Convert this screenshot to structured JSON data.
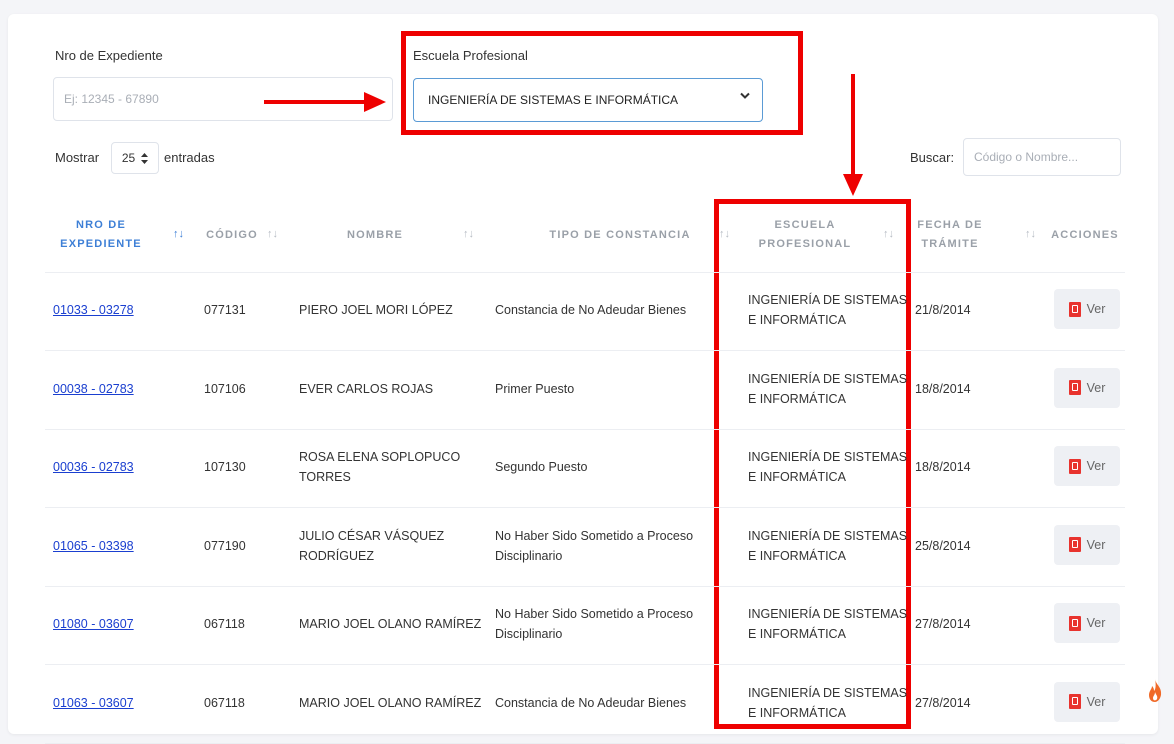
{
  "filters": {
    "expediente_label": "Nro de Expediente",
    "expediente_placeholder": "Ej: 12345 - 67890",
    "escuela_label": "Escuela Profesional",
    "escuela_selected": "INGENIERÍA DE SISTEMAS E INFORMÁTICA"
  },
  "length": {
    "mostrar": "Mostrar",
    "value": "25",
    "entradas": "entradas"
  },
  "search": {
    "label": "Buscar:",
    "placeholder": "Código o Nombre..."
  },
  "columns": {
    "expediente_1": "NRO DE",
    "expediente_2": "EXPEDIENTE",
    "codigo": "CÓDIGO",
    "nombre": "NOMBRE",
    "tipo": "TIPO DE CONSTANCIA",
    "escuela_1": "ESCUELA",
    "escuela_2": "PROFESIONAL",
    "fecha_1": "FECHA DE",
    "fecha_2": "TRÁMITE",
    "acciones": "ACCIONES"
  },
  "rows": [
    {
      "exp": "01033 - 03278",
      "cod": "077131",
      "nom1": "PIERO JOEL MORI LÓPEZ",
      "nom2": "",
      "tipo1": "Constancia de No Adeudar Bienes",
      "tipo2": "",
      "esc1": "INGENIERÍA DE SISTEMAS",
      "esc2": "E INFORMÁTICA",
      "fecha": "21/8/2014",
      "btn": "Ver"
    },
    {
      "exp": "00038 - 02783",
      "cod": "107106",
      "nom1": "EVER CARLOS ROJAS",
      "nom2": "",
      "tipo1": "Primer Puesto",
      "tipo2": "",
      "esc1": "INGENIERÍA DE SISTEMAS",
      "esc2": "E INFORMÁTICA",
      "fecha": "18/8/2014",
      "btn": "Ver"
    },
    {
      "exp": "00036 - 02783",
      "cod": "107130",
      "nom1": "ROSA ELENA SOPLOPUCO",
      "nom2": "TORRES",
      "tipo1": "Segundo Puesto",
      "tipo2": "",
      "esc1": "INGENIERÍA DE SISTEMAS",
      "esc2": "E INFORMÁTICA",
      "fecha": "18/8/2014",
      "btn": "Ver"
    },
    {
      "exp": "01065 - 03398",
      "cod": "077190",
      "nom1": "JULIO CÉSAR VÁSQUEZ",
      "nom2": "RODRÍGUEZ",
      "tipo1": "No Haber Sido Sometido a Proceso",
      "tipo2": "Disciplinario",
      "esc1": "INGENIERÍA DE SISTEMAS",
      "esc2": "E INFORMÁTICA",
      "fecha": "25/8/2014",
      "btn": "Ver"
    },
    {
      "exp": "01080 - 03607",
      "cod": "067118",
      "nom1": "MARIO JOEL OLANO RAMÍREZ",
      "nom2": "",
      "tipo1": "No Haber Sido Sometido a Proceso",
      "tipo2": "Disciplinario",
      "esc1": "INGENIERÍA DE SISTEMAS",
      "esc2": "E INFORMÁTICA",
      "fecha": "27/8/2014",
      "btn": "Ver"
    },
    {
      "exp": "01063 - 03607",
      "cod": "067118",
      "nom1": "MARIO JOEL OLANO RAMÍREZ",
      "nom2": "",
      "tipo1": "Constancia de No Adeudar Bienes",
      "tipo2": "",
      "esc1": "INGENIERÍA DE SISTEMAS",
      "esc2": "E INFORMÁTICA",
      "fecha": "27/8/2014",
      "btn": "Ver"
    }
  ],
  "colors": {
    "annotation": "#ee0000",
    "link": "#1a3fd0",
    "header_accent": "#3d7fd6",
    "pdf": "#e8332e"
  },
  "icons": {
    "select": "chevron-down-icon",
    "length": "updown-caret-icon",
    "pdf": "pdf-icon",
    "fire": "fire-icon"
  }
}
